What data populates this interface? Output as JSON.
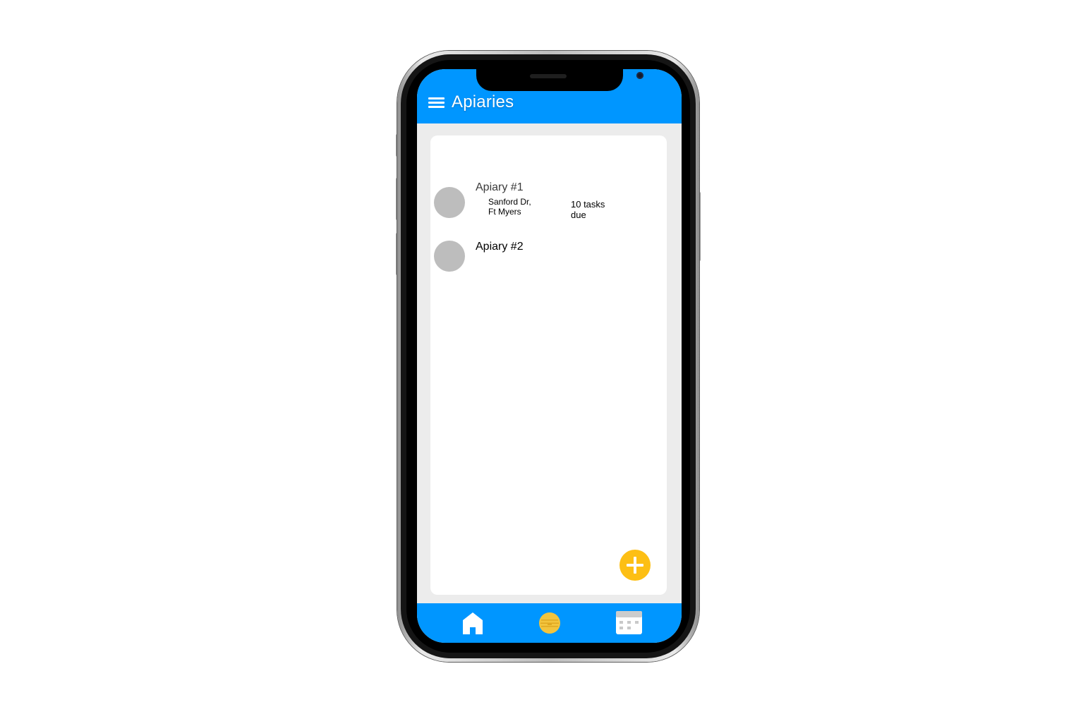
{
  "header": {
    "title": "Apiaries",
    "menu_icon": "hamburger-menu-icon"
  },
  "apiaries": [
    {
      "name": "Apiary #1",
      "address_line1": "Sanford Dr,",
      "address_line2": "Ft Myers",
      "tasks_line1": "10 tasks",
      "tasks_line2": "due"
    },
    {
      "name": "Apiary #2"
    }
  ],
  "fab": {
    "icon": "plus-icon"
  },
  "bottom_nav": {
    "items": [
      {
        "icon": "home-icon"
      },
      {
        "icon": "beehive-icon"
      },
      {
        "icon": "calendar-icon"
      }
    ]
  },
  "colors": {
    "primary": "#0096ff",
    "accent": "#fdbf14",
    "background": "#ececec",
    "card": "#ffffff",
    "avatar": "#bdbdbd"
  }
}
